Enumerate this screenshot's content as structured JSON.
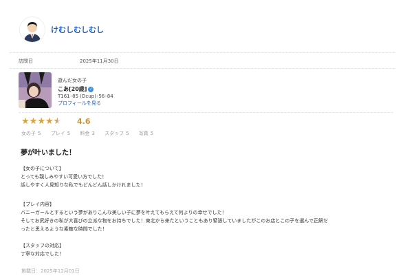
{
  "user": {
    "name": "けむしむしむし"
  },
  "visit": {
    "label": "訪問日",
    "date": "2025年11月30日"
  },
  "girl": {
    "label": "遊んだ女の子",
    "name": "こあ[20歳]",
    "spec": "T161･85 (Dcup)･56･84",
    "profile_link": "プロフィールを見る"
  },
  "rating": {
    "value": "4.6",
    "scores": [
      {
        "label": "女の子",
        "value": "5"
      },
      {
        "label": "プレイ",
        "value": "5"
      },
      {
        "label": "料金",
        "value": "3"
      },
      {
        "label": "スタッフ",
        "value": "5"
      },
      {
        "label": "写真",
        "value": "5"
      }
    ]
  },
  "review": {
    "title": "夢が叶いました！",
    "lines": [
      "【女の子について】",
      "とっても親しみやすい可愛い方でした！",
      "話しやすく人見知りな私でもどんどん話しかけれました！",
      "",
      "【プレイ内容】",
      "バニーガールとするという夢がありこんな美しい子に夢を叶えてもらえて何よりの幸せでした！",
      "そしてお尻好きの私が大喜びの立派な物をお持ちでした！東北から来たということもあり緊張していましたがこのお店とこの子を選んで正解だ",
      "ったと思えるような素敵な時間でした！",
      "",
      "【スタッフの対応】",
      "丁寧な対応でした！"
    ],
    "posted": "掲載日：2025年12月01日"
  },
  "colors": {
    "link": "#1f5fbf",
    "star": "#d9a23a"
  }
}
